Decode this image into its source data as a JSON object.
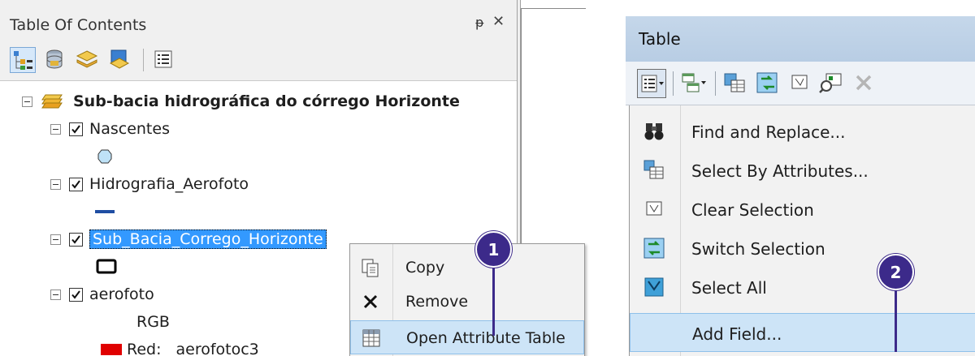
{
  "toc": {
    "title": "Table Of Contents",
    "pin_glyph": "ᵽ",
    "close_glyph": "✕",
    "toolbar_icons": [
      "list-by-drawing-order-icon",
      "list-by-source-icon",
      "list-by-visibility-icon",
      "list-by-selection-icon",
      "options-icon"
    ],
    "group_name": "Sub-bacia hidrográfica do córrego Horizonte",
    "layers": [
      {
        "name": "Nascentes",
        "checked": true
      },
      {
        "name": "Hidrografia_Aerofoto",
        "checked": true
      },
      {
        "name": "Sub_Bacia_Corrego_Horizonte",
        "checked": true,
        "selected": true
      },
      {
        "name": "aerofoto",
        "checked": true
      }
    ],
    "raster_label": "RGB",
    "red_band_label": "Red:",
    "red_band_value": "aerofotoc3"
  },
  "context_menu": {
    "items": [
      {
        "label": "Copy",
        "icon": "copy-icon"
      },
      {
        "label": "Remove",
        "icon": "remove-icon"
      },
      {
        "label": "Open Attribute Table",
        "icon": "attribute-table-icon",
        "highlighted": true
      }
    ]
  },
  "callouts": {
    "one": "1",
    "two": "2"
  },
  "table_window": {
    "title": "Table",
    "toolbar_icons": [
      "table-options-icon",
      "related-tables-icon",
      "select-by-attributes-icon",
      "switch-selection-icon",
      "clear-selection-icon",
      "zoom-to-selected-icon",
      "delete-selected-icon"
    ],
    "menu_items": [
      {
        "label": "Find and Replace...",
        "icon": "binoculars-icon"
      },
      {
        "label": "Select By Attributes...",
        "icon": "select-by-attributes-icon"
      },
      {
        "label": "Clear Selection",
        "icon": "clear-selection-icon"
      },
      {
        "label": "Switch Selection",
        "icon": "switch-selection-icon"
      },
      {
        "label": "Select All",
        "icon": "select-all-icon"
      },
      {
        "label": "Add Field...",
        "icon": "",
        "highlighted": true
      }
    ]
  },
  "colors": {
    "selection_blue": "#3399ff",
    "callout_purple": "#3c2a8a",
    "hover_blue": "#cde4f7",
    "river_blue": "#1f4ea3",
    "red_band": "#e00000"
  }
}
